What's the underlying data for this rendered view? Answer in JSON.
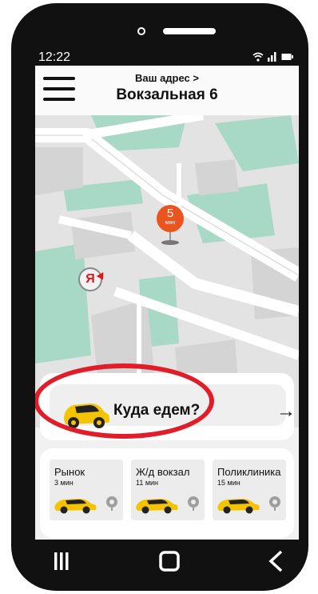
{
  "status": {
    "time": "12:22"
  },
  "header": {
    "caption": "Ваш адрес >",
    "address": "Вокзальная 6"
  },
  "map": {
    "pin_minutes": "5",
    "pin_unit": "мин",
    "logo_letter": "Я"
  },
  "where": {
    "label": "Куда едем?",
    "arrow": "→"
  },
  "quick": [
    {
      "name": "Рынок",
      "time": "3 мин"
    },
    {
      "name": "Ж/д вокзал",
      "time": "11 мин"
    },
    {
      "name": "Поликлиника",
      "time": "15 мин"
    }
  ],
  "icons": {
    "menu": "hamburger-icon",
    "locate": "navigation-arrow-icon",
    "car": "taxi-car-icon",
    "pin": "map-pin-icon",
    "back": "back-chevron-icon",
    "home": "home-square-icon",
    "recent": "recent-apps-icon"
  },
  "colors": {
    "taxi": "#f5c400",
    "pin": "#e9541f",
    "highlight": "#e11d2a",
    "map_green": "#a8d8c6"
  }
}
